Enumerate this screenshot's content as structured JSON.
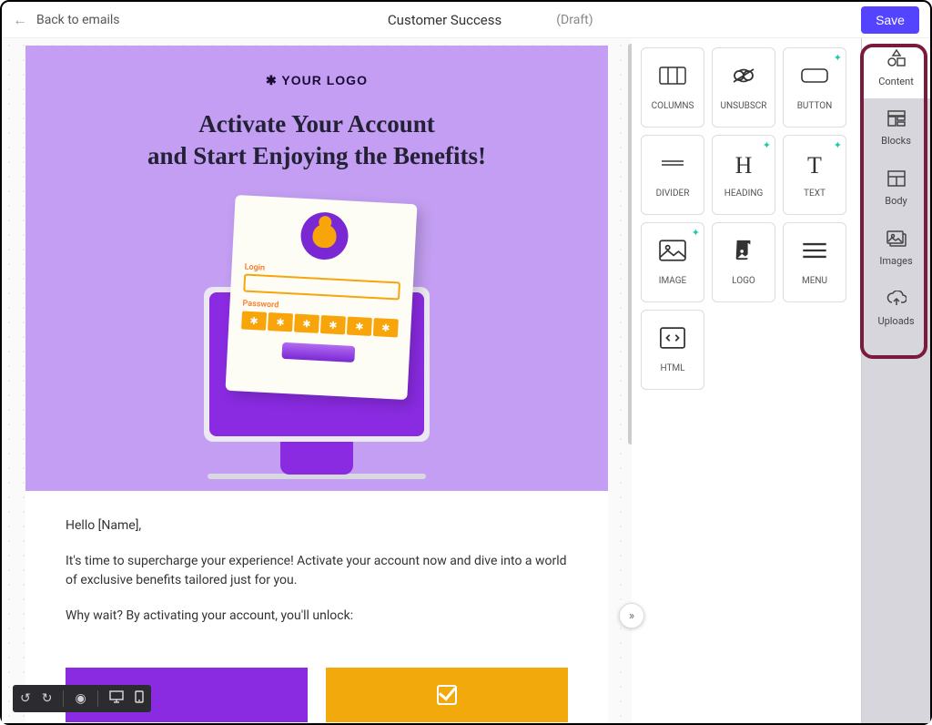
{
  "header": {
    "back_label": "Back to emails",
    "title": "Customer Success",
    "status": "(Draft)",
    "save_label": "Save"
  },
  "email": {
    "logo_text": "✱ YOUR LOGO",
    "headline_line1": "Activate Your Account",
    "headline_line2": "and Start Enjoying the Benefits!",
    "login_label": "Login",
    "password_label": "Password",
    "pwd_mask": "✱",
    "greeting": "Hello [Name],",
    "para1": "It's time to supercharge your experience! Activate your account now and dive into a world of exclusive benefits tailored just for you.",
    "para2": "Why wait? By activating your account, you'll unlock:"
  },
  "tools": [
    {
      "label": "COLUMNS",
      "sparkle": false
    },
    {
      "label": "UNSUBSCR",
      "sparkle": false
    },
    {
      "label": "BUTTON",
      "sparkle": true
    },
    {
      "label": "DIVIDER",
      "sparkle": false
    },
    {
      "label": "HEADING",
      "sparkle": true
    },
    {
      "label": "TEXT",
      "sparkle": true
    },
    {
      "label": "IMAGE",
      "sparkle": true
    },
    {
      "label": "LOGO",
      "sparkle": false
    },
    {
      "label": "MENU",
      "sparkle": false
    },
    {
      "label": "HTML",
      "sparkle": false
    }
  ],
  "tabs": [
    {
      "label": "Content",
      "active": true
    },
    {
      "label": "Blocks",
      "active": false
    },
    {
      "label": "Body",
      "active": false
    },
    {
      "label": "Images",
      "active": false
    },
    {
      "label": "Uploads",
      "active": false
    }
  ],
  "expand_glyph": "»"
}
